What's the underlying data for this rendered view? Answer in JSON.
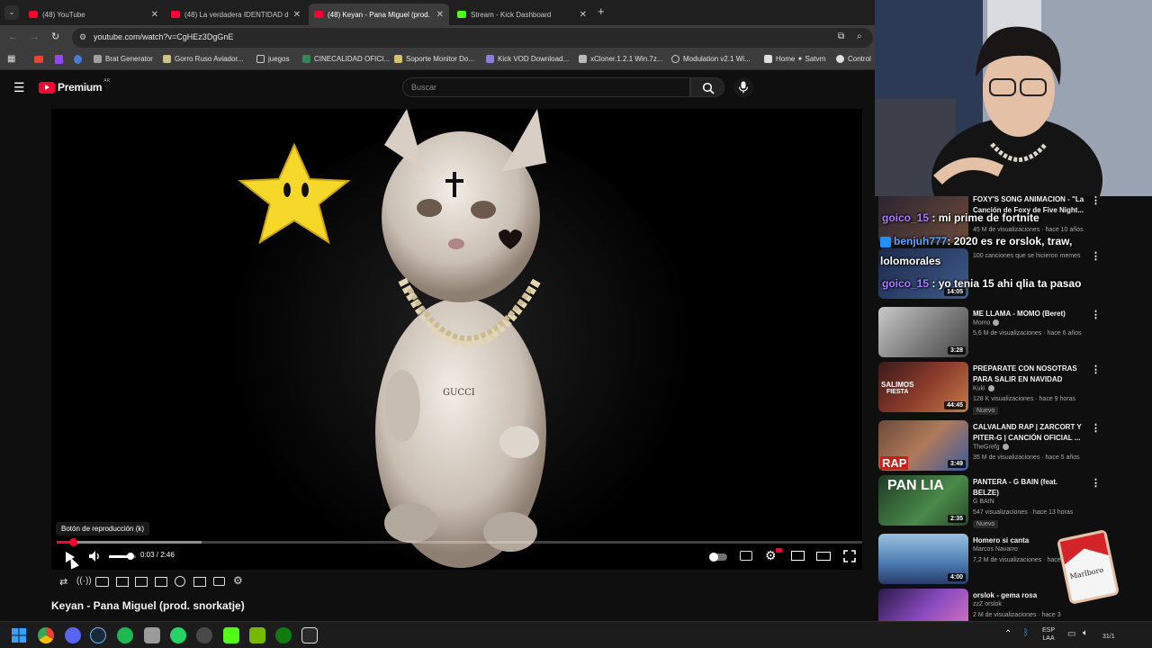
{
  "browser": {
    "tabs": [
      {
        "title": "(48) YouTube",
        "active": false,
        "favicon_color": "#ff0033"
      },
      {
        "title": "(48) La verdadera IDENTIDAD d",
        "active": false,
        "favicon_color": "#ff0033"
      },
      {
        "title": "(48) Keyan - Pana Miguel (prod.",
        "active": true,
        "favicon_color": "#ff0033"
      },
      {
        "title": "Stream - Kick Dashboard",
        "active": false,
        "favicon_color": "#53fc18"
      }
    ],
    "url": "youtube.com/watch?v=CgHEz3DgGnE",
    "bookmarks": [
      "Brat Generator",
      "Gorro Ruso Aviador...",
      "juegos",
      "CINECALIDAD OFICI...",
      "Soporte Monitor Do...",
      "Kick VOD Download...",
      "xCloner.1.2.1 Win.7z...",
      "Modulation v2.1 Wi...",
      "Home ✦ Satvrn",
      "Control"
    ]
  },
  "youtube": {
    "logo_text": "Premium",
    "logo_sup": "AR",
    "search_placeholder": "Buscar"
  },
  "player": {
    "tooltip": "Botón de reproducción (k)",
    "time": "0:03 / 2:46",
    "progress_fraction": 0.02,
    "buffered_fraction": 0.18,
    "volume_fraction": 0.8
  },
  "video_title": "Keyan - Pana Miguel (prod. snorkatje)",
  "chat": [
    {
      "user": "goico_15",
      "sep": " : ",
      "message": "mi prime de fortnite"
    },
    {
      "user": "benjuh777",
      "sep": ": ",
      "message": "2020 es re orslok, traw,"
    },
    {
      "user": "",
      "sep": "",
      "message": "lolomorales"
    },
    {
      "user": "goico_15",
      "sep": " : ",
      "message": "yo tenia 15 ahi qlia ta pasao"
    }
  ],
  "recommendations": [
    {
      "title": "FOXY'S SONG ANIMACIÓN - \"La Canción de Foxy de Five Night...",
      "channel": "",
      "meta": "45 M de visualizaciones · hace 10 años",
      "duration": "",
      "badge": ""
    },
    {
      "title": "",
      "channel": "",
      "meta": "100 canciones que se hicieron memes",
      "duration": "14:05",
      "badge": ""
    },
    {
      "title": "ME LLAMA - MOMO (Beret)",
      "channel": "Momo",
      "meta": "5,6 M de visualizaciones · hace 6 años",
      "duration": "3:28",
      "badge": ""
    },
    {
      "title": "PREPARATE CON NOSOTRAS PARA SALIR EN NAVIDAD",
      "channel": "Kuki",
      "meta": "128 K visualizaciones · hace 9 horas",
      "duration": "44:45",
      "badge": "Nuevo"
    },
    {
      "title": "CALVALAND RAP | ZARCORT Y PITER-G | CANCIÓN OFICIAL ...",
      "channel": "TheGrefg",
      "meta": "35 M de visualizaciones · hace 5 años",
      "duration": "3:49",
      "badge": ""
    },
    {
      "title": "PANTERA - G BAIN (feat. BELZE)",
      "channel": "G BAIN",
      "meta": "547 visualizaciones · hace 13 horas",
      "duration": "2:35",
      "badge": "Nuevo"
    },
    {
      "title": "Homero si canta",
      "channel": "Marcos Navarro",
      "meta": "7,2 M de visualizaciones · hace",
      "duration": "4:00",
      "badge": ""
    },
    {
      "title": "orslok - gema rosa",
      "channel": "zzZ orslok",
      "meta": "2 M de visualizaciones · hace 3",
      "duration": "",
      "badge": ""
    }
  ],
  "thumb_text": {
    "salimos": "SALIMOS",
    "fiesta": "FIESTA",
    "rap": "RAP",
    "pantera": "PAN LIA",
    "marlboro": "Marlboro"
  },
  "video_overlay": {
    "gucci": "GUCCI"
  },
  "taskbar": {
    "lang": "ESP",
    "region": "LAA",
    "date": "31/1"
  },
  "colors": {
    "accent_red": "#ff0033",
    "kick_green": "#53fc18",
    "chat_user": "#a97cff"
  }
}
